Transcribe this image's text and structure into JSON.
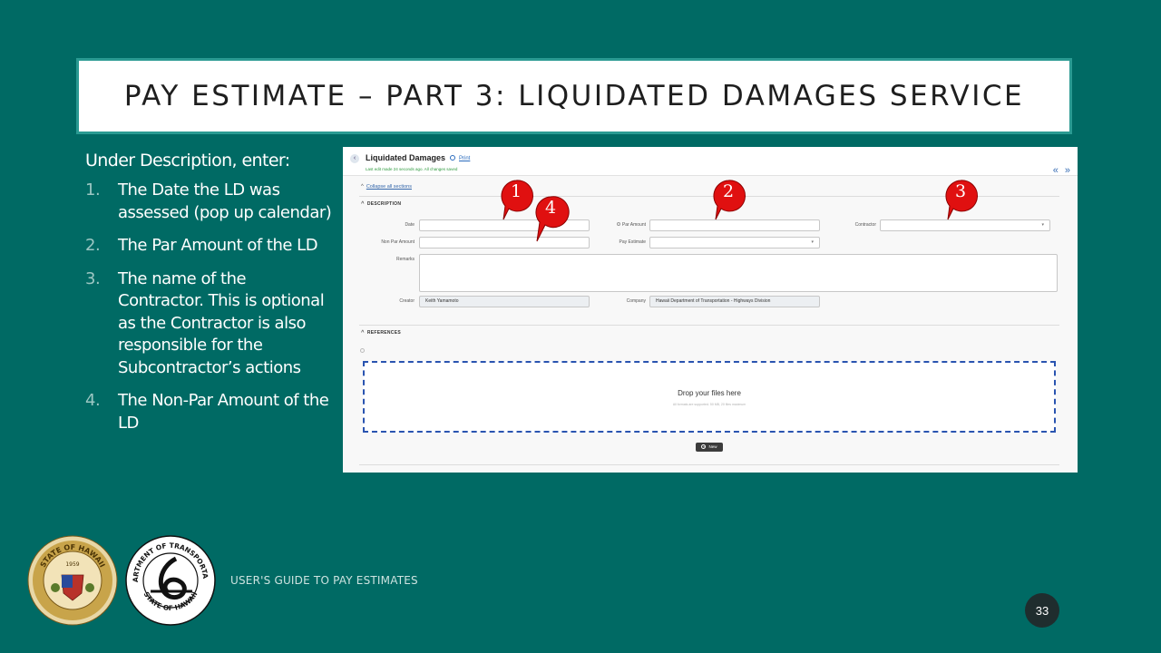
{
  "slide": {
    "title": "PAY ESTIMATE – PART 3: LIQUIDATED DAMAGES SERVICE",
    "intro": "Under Description, enter:",
    "steps": [
      {
        "num": "1.",
        "text": "The Date the LD was assessed (pop up calendar)"
      },
      {
        "num": "2.",
        "text": "The Par Amount of the LD"
      },
      {
        "num": "3.",
        "text": "The name of the Contractor. This is optional as the Contractor is also responsible for the Subcontractor’s actions"
      },
      {
        "num": "4.",
        "text": "The Non-Par Amount of the LD"
      }
    ],
    "footer": "USER'S GUIDE TO PAY ESTIMATES",
    "page_number": "33",
    "seal_state_text": "STATE OF HAWAII",
    "seal_state_year": "1959",
    "seal_dot_text": "DEPARTMENT OF TRANSPORTATION",
    "seal_dot_bottom": "STATE OF HAWAII"
  },
  "screenshot": {
    "page_title": "Liquidated Damages",
    "print_label": "Print",
    "saved_status": "Last edit made 24 seconds ago. All changes saved",
    "nav_arrows": "« »",
    "collapse_link": "Collapse all sections",
    "section_description": "DESCRIPTION",
    "section_references": "REFERENCES",
    "labels": {
      "date": "Date",
      "par_amount": "Par Amount",
      "contractor": "Contractor",
      "non_par_amount": "Non Par Amount",
      "pay_estimate": "Pay Estimate",
      "remarks": "Remarks",
      "creator": "Creator",
      "company": "Company"
    },
    "values": {
      "date": "",
      "par_amount": "",
      "contractor": "",
      "non_par_amount": "",
      "pay_estimate": "",
      "remarks": "",
      "creator": "Keith Yamamoto",
      "company": "Hawaii Department of Transportation - Highways Division"
    },
    "dropzone_text": "Drop your files here",
    "dropzone_subtext": "All formats are supported. 50 MB, 20 files maximum",
    "new_button": "New"
  },
  "callouts": [
    "1",
    "2",
    "3",
    "4"
  ],
  "colors": {
    "background": "#006a64",
    "title_border": "#2a9a92",
    "callout_red": "#e01010",
    "dropzone_border": "#2a54b0"
  }
}
